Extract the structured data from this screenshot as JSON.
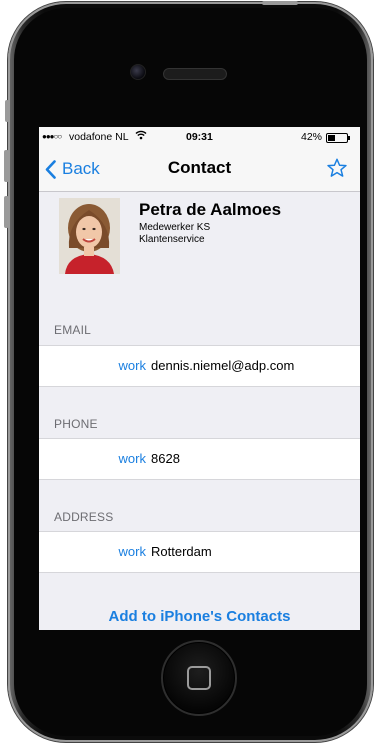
{
  "status": {
    "signal": "●●●○○",
    "carrier": "vodafone NL",
    "time": "09:31",
    "battery": "42%",
    "battery_level": 0.42
  },
  "nav": {
    "back_label": "Back",
    "title": "Contact"
  },
  "contact": {
    "name": "Petra de Aalmoes",
    "role": "Medewerker KS",
    "department": "Klantenservice"
  },
  "sections": {
    "email": {
      "header": "EMAIL",
      "kind": "work",
      "value": "dennis.niemel@adp.com"
    },
    "phone": {
      "header": "PHONE",
      "kind": "work",
      "value": "8628"
    },
    "address": {
      "header": "ADDRESS",
      "kind": "work",
      "value": "Rotterdam"
    }
  },
  "actions": {
    "add_to_contacts": "Add to iPhone's Contacts"
  },
  "colors": {
    "accent": "#1a7fe0",
    "background": "#efeff4"
  }
}
